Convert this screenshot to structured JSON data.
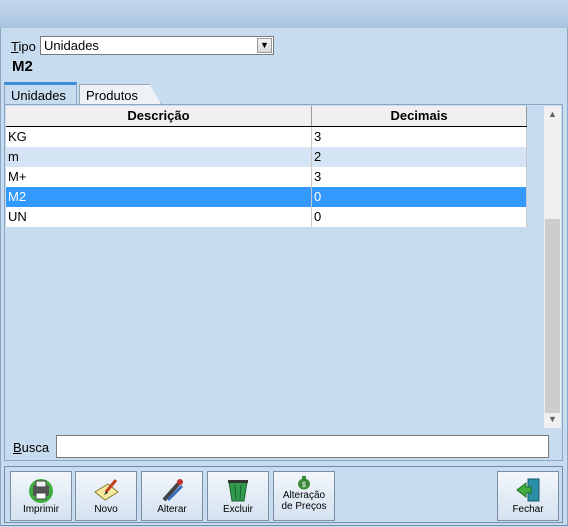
{
  "filter": {
    "label_prefix": "T",
    "label_rest": "ipo",
    "value": "Unidades"
  },
  "current_code": "M2",
  "tabs": [
    {
      "label": "Unidades"
    },
    {
      "label": "Produtos"
    }
  ],
  "grid": {
    "headers": [
      "Descrição",
      "Decimais"
    ],
    "rows": [
      {
        "descricao": "KG",
        "decimais": "3"
      },
      {
        "descricao": "m",
        "decimais": "2"
      },
      {
        "descricao": "M+",
        "decimais": "3"
      },
      {
        "descricao": "M2",
        "decimais": "0",
        "selected": true
      },
      {
        "descricao": "UN",
        "decimais": "0"
      }
    ]
  },
  "search": {
    "label_prefix": "B",
    "label_rest": "usca",
    "value": ""
  },
  "toolbar": {
    "imprimir": "Imprimir",
    "novo": "Novo",
    "alterar": "Alterar",
    "excluir": "Excluir",
    "alteracao_1": "Alteração",
    "alteracao_2": "de Preços",
    "fechar": "Fechar"
  },
  "icons": {
    "imprimir": "printer-icon",
    "novo": "new-document-icon",
    "alterar": "edit-pen-icon",
    "excluir": "trash-can-icon",
    "alteracao": "money-bag-icon",
    "fechar": "exit-door-icon"
  },
  "colors": {
    "selection": "#3399ff",
    "stripe": "#d4e4f4",
    "tab_accent": "#3c8ad8"
  }
}
